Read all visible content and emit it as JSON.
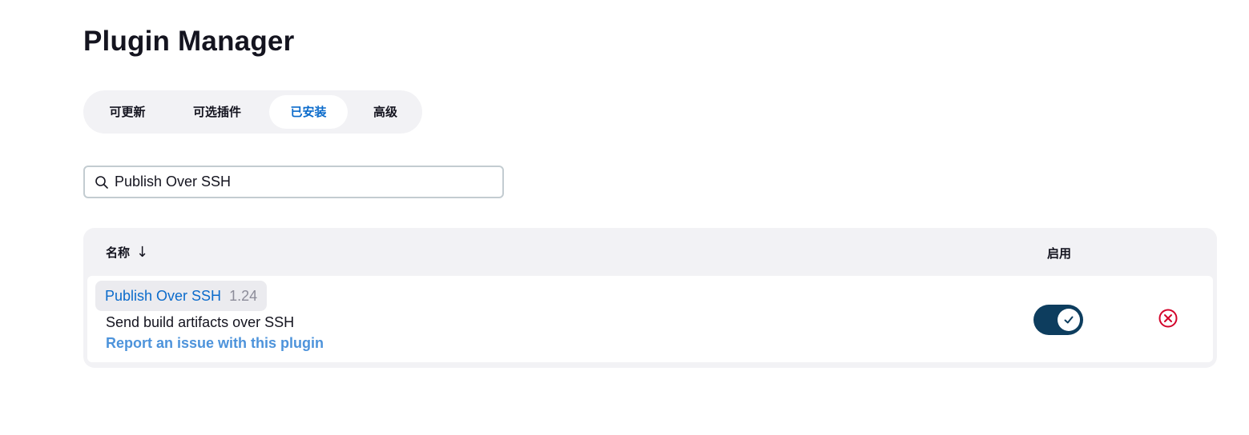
{
  "page": {
    "title": "Plugin Manager"
  },
  "tabs": [
    {
      "label": "可更新",
      "active": false
    },
    {
      "label": "可选插件",
      "active": false
    },
    {
      "label": "已安装",
      "active": true
    },
    {
      "label": "高级",
      "active": false
    }
  ],
  "search": {
    "value": "Publish Over SSH",
    "icon": "search-icon"
  },
  "table": {
    "headers": {
      "name": "名称",
      "name_sort_indicator": "↓",
      "enabled": "启用"
    },
    "rows": [
      {
        "name": "Publish Over SSH",
        "version": "1.24",
        "description": "Send build artifacts over SSH",
        "report_link": "Report an issue with this plugin",
        "enabled": true
      }
    ]
  },
  "colors": {
    "accent": "#0b6bcb",
    "link_light": "#4d93db",
    "toggle_on": "#0d3d5e",
    "danger": "#d3052b",
    "panel_bg": "#f2f2f5"
  }
}
